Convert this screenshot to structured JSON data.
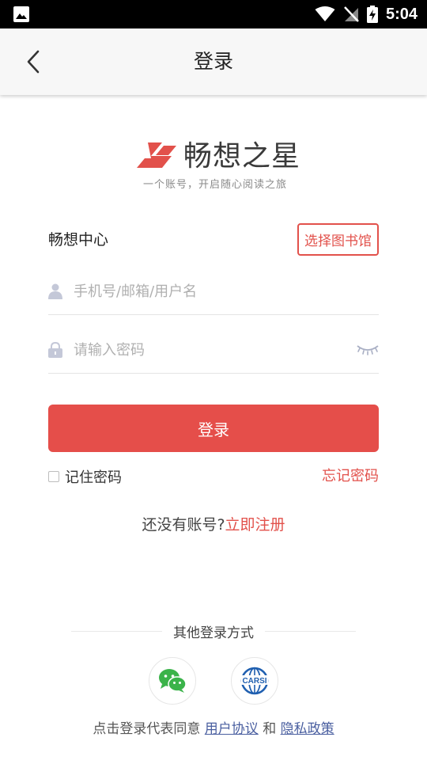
{
  "status_bar": {
    "time": "5:04"
  },
  "header": {
    "title": "登录"
  },
  "logo": {
    "name": "畅想之星",
    "slogan": "一个账号，开启随心阅读之旅",
    "brand_color": "#e2514b"
  },
  "center": {
    "name": "畅想中心",
    "choose_library_label": "选择图书馆"
  },
  "form": {
    "username_placeholder": "手机号/邮箱/用户名",
    "password_placeholder": "请输入密码",
    "login_label": "登录",
    "remember_label": "记住密码",
    "remember_checked": false,
    "forgot_label": "忘记密码"
  },
  "register": {
    "prompt": "还没有账号?",
    "link": "立即注册"
  },
  "other_login": {
    "title": "其他登录方式",
    "methods": [
      {
        "name": "wechat-icon"
      },
      {
        "name": "carsi-icon",
        "label": "CARSI"
      }
    ]
  },
  "agreement": {
    "prefix": "点击登录代表同意",
    "user_agreement": "用户协议",
    "and": "和",
    "privacy_policy": "隐私政策"
  },
  "colors": {
    "accent": "#e54e4a",
    "link_blue": "#4a5fa0",
    "wechat_green": "#3bb34a"
  }
}
